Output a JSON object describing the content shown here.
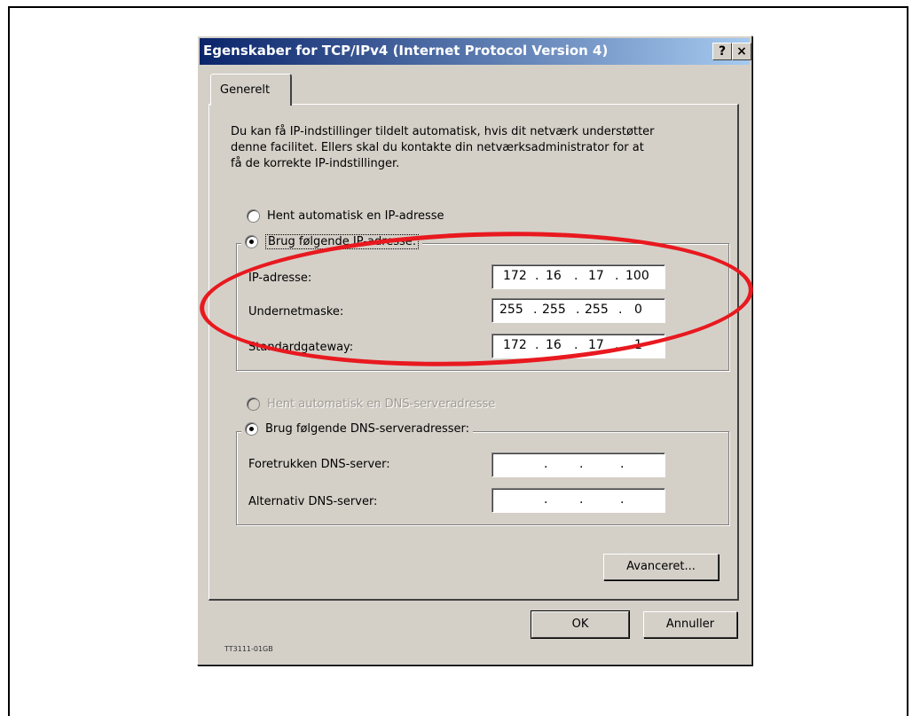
{
  "window": {
    "title": "Egenskaber for TCP/IPv4 (Internet Protocol Version 4)",
    "help_button": "?",
    "close_button": "×"
  },
  "tab": {
    "label": "Generelt"
  },
  "intro_text": "Du kan få IP-indstillinger tildelt automatisk, hvis dit netværk understøtter denne facilitet. Ellers skal du kontakte din netværksadministrator for at få de korrekte IP-indstillinger.",
  "ip": {
    "auto_option": "Hent automatisk en IP-adresse",
    "manual_option": "Brug følgende IP-adresse:",
    "fields": [
      {
        "label": "IP-adresse:",
        "octets": [
          "172",
          "16",
          "17",
          "100"
        ]
      },
      {
        "label": "Undernetmaske:",
        "octets": [
          "255",
          "255",
          "255",
          "0"
        ]
      },
      {
        "label": "Standardgateway:",
        "octets": [
          "172",
          "16",
          "17",
          "1"
        ]
      }
    ]
  },
  "dns": {
    "auto_option": "Hent automatisk en DNS-serveradresse",
    "manual_option": "Brug følgende DNS-serveradresser:",
    "fields": [
      {
        "label": "Foretrukken DNS-server:",
        "octets": [
          "",
          "",
          "",
          ""
        ]
      },
      {
        "label": "Alternativ DNS-server:",
        "octets": [
          "",
          "",
          "",
          ""
        ]
      }
    ]
  },
  "buttons": {
    "advanced": "Avanceret...",
    "ok": "OK",
    "cancel": "Annuller"
  },
  "caption": "TT3111-01GB",
  "colors": {
    "annotation": "#e8191f",
    "titlebar": "#0a246a"
  }
}
